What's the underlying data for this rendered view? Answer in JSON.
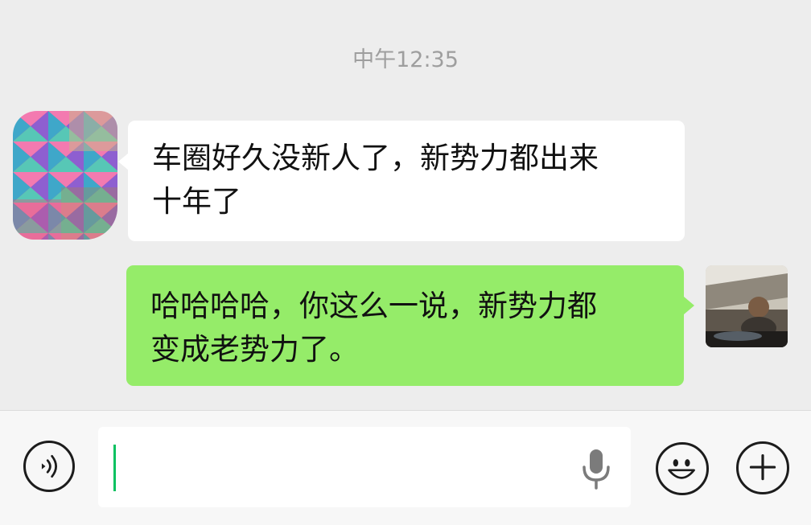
{
  "chat": {
    "timestamp": "中午12:35",
    "messages": [
      {
        "direction": "incoming",
        "avatar": "pixelated-avatar",
        "lines": [
          "车圈好久没新人了，新势力都出来",
          "十年了"
        ]
      },
      {
        "direction": "outgoing",
        "avatar": "photo-avatar",
        "lines": [
          "哈哈哈哈，你这么一说，新势力都",
          "变成老势力了。"
        ]
      }
    ]
  },
  "input_bar": {
    "voice_icon": "voice-mode-icon",
    "mic_icon": "microphone-icon",
    "emoji_icon": "emoji-icon",
    "more_icon": "plus-icon",
    "input_value": ""
  },
  "colors": {
    "background": "#ededed",
    "incoming_bubble": "#ffffff",
    "outgoing_bubble": "#95ec69",
    "caret": "#07c160",
    "timestamp": "#9e9e9e"
  }
}
